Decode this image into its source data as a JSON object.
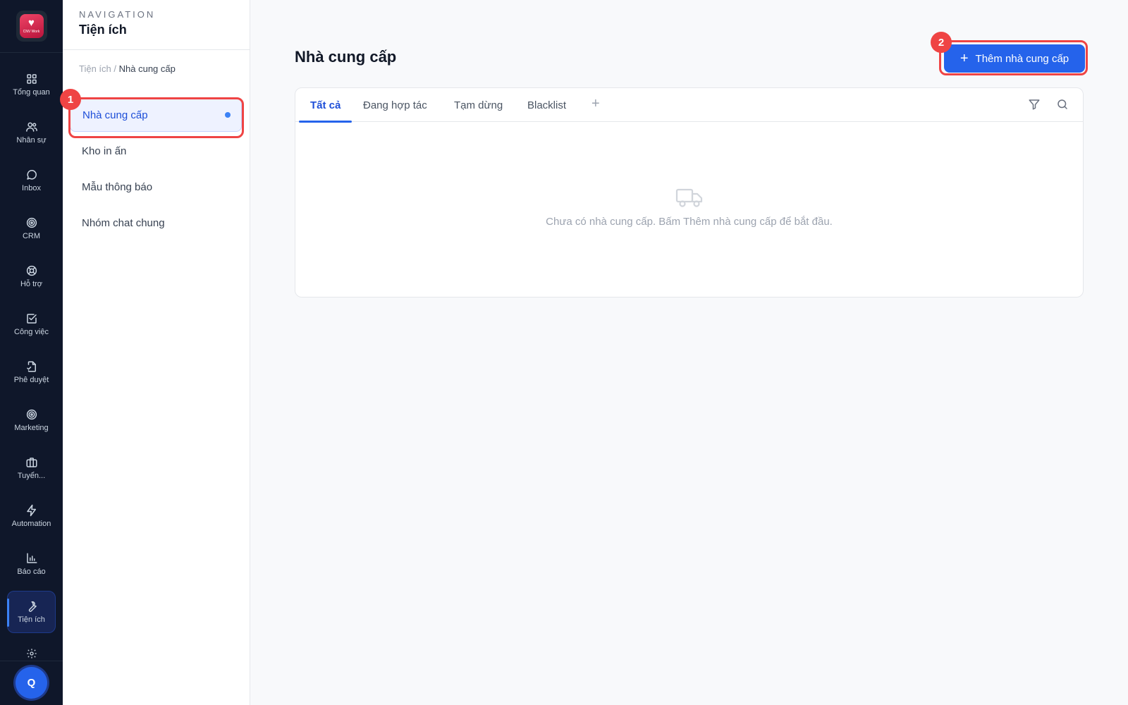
{
  "app": {
    "logo_icon": "heart-logo-icon",
    "logo_brand": "CNV Work"
  },
  "rail": {
    "items": [
      {
        "label": "Tổng quan",
        "icon": "grid-icon"
      },
      {
        "label": "Nhân sự",
        "icon": "users-icon"
      },
      {
        "label": "Inbox",
        "icon": "chat-bubble-icon"
      },
      {
        "label": "CRM",
        "icon": "target-icon"
      },
      {
        "label": "Hỗ trợ",
        "icon": "lifebuoy-icon"
      },
      {
        "label": "Công việc",
        "icon": "checkbox-icon"
      },
      {
        "label": "Phê duyệt",
        "icon": "document-sign-icon"
      },
      {
        "label": "Marketing",
        "icon": "target-icon"
      },
      {
        "label": "Tuyển...",
        "icon": "briefcase-icon"
      },
      {
        "label": "Automation",
        "icon": "lightning-icon"
      },
      {
        "label": "Báo cáo",
        "icon": "bar-chart-icon"
      },
      {
        "label": "Tiện ích",
        "icon": "wrench-icon",
        "active": true
      }
    ],
    "settings_icon": "gear-icon",
    "avatar_initial": "Q"
  },
  "subnav": {
    "kicker": "NAVIGATION",
    "title": "Tiện ích",
    "breadcrumb": {
      "parent": "Tiện ích",
      "sep": "/",
      "current": "Nhà cung cấp"
    },
    "items": [
      {
        "label": "Nhà cung cấp",
        "active": true
      },
      {
        "label": "Kho in ấn"
      },
      {
        "label": "Mẫu thông báo"
      },
      {
        "label": "Nhóm chat chung"
      }
    ]
  },
  "annotations": {
    "badge1": "1",
    "badge2": "2",
    "color": "#ef4444"
  },
  "main": {
    "title": "Nhà cung cấp",
    "add_button": {
      "icon": "plus-icon",
      "plus": "+",
      "label": "Thêm nhà cung cấp"
    },
    "tabs": [
      "Tất cả",
      "Đang hợp tác",
      "Tạm dừng",
      "Blacklist"
    ],
    "tab_add": "+",
    "active_tab": "Tất cả",
    "toolbar_icons": [
      "filter-icon",
      "search-icon"
    ],
    "empty_state": {
      "icon": "truck-icon",
      "text": "Chưa có nhà cung cấp. Bấm Thêm nhà cung cấp để bắt đầu."
    }
  },
  "colors": {
    "accent": "#2563eb",
    "rail_bg": "#0f172a",
    "annotation": "#ef4444"
  }
}
